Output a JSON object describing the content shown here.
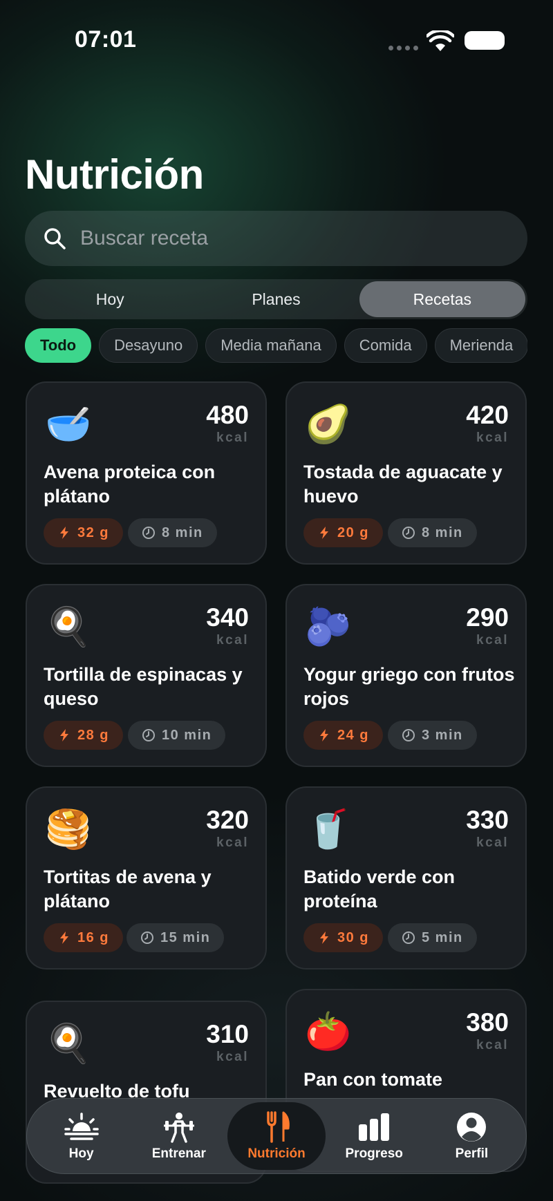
{
  "status_bar": {
    "time": "07:01"
  },
  "page_title": "Nutrición",
  "search": {
    "placeholder": "Buscar receta",
    "value": ""
  },
  "segments": [
    {
      "label": "Hoy",
      "active": false
    },
    {
      "label": "Planes",
      "active": false
    },
    {
      "label": "Recetas",
      "active": true
    }
  ],
  "chips": [
    {
      "label": "Todo",
      "active": true
    },
    {
      "label": "Desayuno",
      "active": false
    },
    {
      "label": "Media mañana",
      "active": false
    },
    {
      "label": "Comida",
      "active": false
    },
    {
      "label": "Merienda",
      "active": false
    }
  ],
  "recipes": [
    {
      "emoji": "🥣",
      "kcal": "480",
      "kcal_unit": "kcal",
      "title": "Avena proteica con plátano",
      "protein": "32 g",
      "time": "8 min"
    },
    {
      "emoji": "🥑",
      "kcal": "420",
      "kcal_unit": "kcal",
      "title": "Tostada de aguacate y huevo",
      "protein": "20 g",
      "time": "8 min"
    },
    {
      "emoji": "🍳",
      "kcal": "340",
      "kcal_unit": "kcal",
      "title": "Tortilla de espinacas y queso",
      "protein": "28 g",
      "time": "10 min"
    },
    {
      "emoji": "🫐",
      "kcal": "290",
      "kcal_unit": "kcal",
      "title": "Yogur griego con frutos rojos",
      "protein": "24 g",
      "time": "3 min"
    },
    {
      "emoji": "🥞",
      "kcal": "320",
      "kcal_unit": "kcal",
      "title": "Tortitas de avena y plátano",
      "protein": "16 g",
      "time": "15 min"
    },
    {
      "emoji": "🥤",
      "kcal": "330",
      "kcal_unit": "kcal",
      "title": "Batido verde con proteína",
      "protein": "30 g",
      "time": "5 min"
    },
    {
      "emoji": "🍳",
      "kcal": "310",
      "kcal_unit": "kcal",
      "title": "Revuelto de tofu",
      "protein": "",
      "time": ""
    },
    {
      "emoji": "🍅",
      "kcal": "380",
      "kcal_unit": "kcal",
      "title": "Pan con tomate",
      "protein": "",
      "time": ""
    }
  ],
  "tab_bar": [
    {
      "label": "Hoy",
      "icon": "sunrise-icon",
      "active": false
    },
    {
      "label": "Entrenar",
      "icon": "weightlifter-icon",
      "active": false
    },
    {
      "label": "Nutrición",
      "icon": "fork-knife-icon",
      "active": true
    },
    {
      "label": "Progreso",
      "icon": "bar-chart-icon",
      "active": false
    },
    {
      "label": "Perfil",
      "icon": "person-circle-icon",
      "active": false
    }
  ],
  "colors": {
    "accent_green": "#3dd68c",
    "accent_orange": "#ff7a2e",
    "background": "#0a0f10",
    "card": "#1a1e22"
  }
}
